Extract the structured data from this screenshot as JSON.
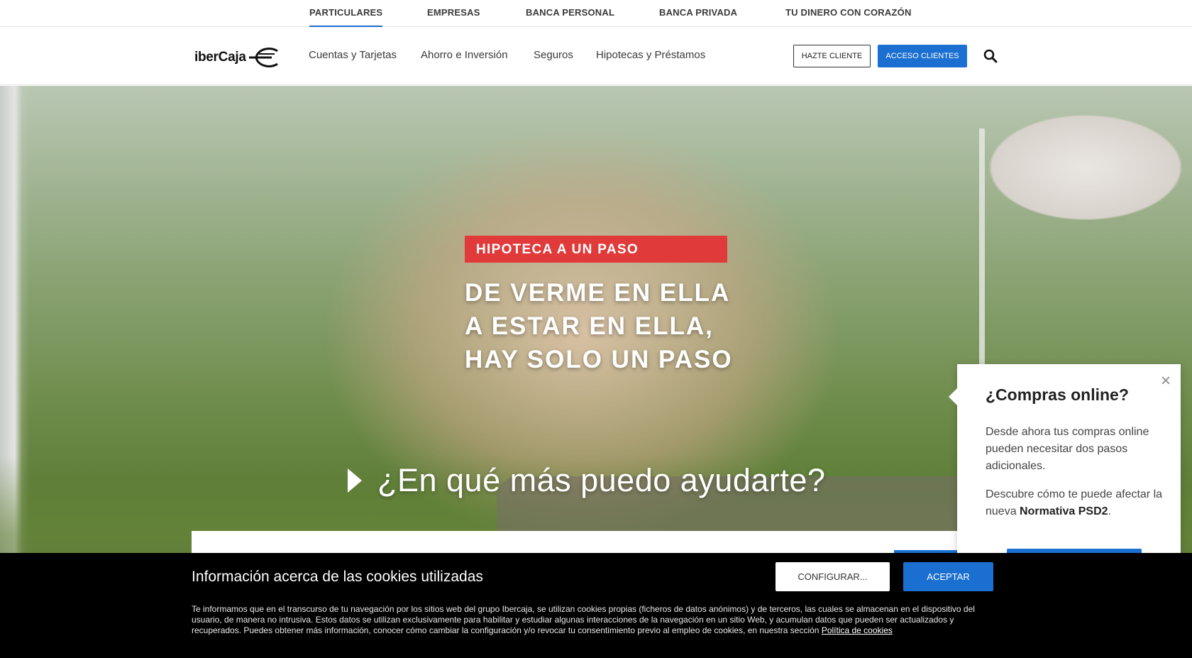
{
  "segments": [
    {
      "label": "PARTICULARES",
      "active": true
    },
    {
      "label": "EMPRESAS",
      "active": false
    },
    {
      "label": "BANCA PERSONAL",
      "active": false
    },
    {
      "label": "BANCA PRIVADA",
      "active": false
    },
    {
      "label": "TU DINERO CON CORAZÓN",
      "active": false
    }
  ],
  "header": {
    "logo_text": "iberCaja",
    "nav": [
      "Cuentas y Tarjetas",
      "Ahorro e Inversión",
      "Seguros",
      "Hipotecas y Préstamos"
    ],
    "hazte_cliente": "HAZTE CLIENTE",
    "acceso_clientes": "ACCESO CLIENTES",
    "search_icon": "search-icon"
  },
  "hero": {
    "tag": "HIPOTECA A UN PASO",
    "headline_lines": [
      "DE VERME EN ELLA",
      "A ESTAR EN ELLA,",
      "HAY SOLO UN PASO"
    ],
    "help_text": "¿En qué más puedo ayudarte?"
  },
  "popup": {
    "title": "¿Compras online?",
    "p1": "Desde ahora tus compras online pueden necesitar dos pasos adicionales.",
    "p2_prefix": "Descubre cómo te puede afectar la nueva ",
    "p2_bold": "Normativa PSD2",
    "p2_suffix": ".",
    "close": "×"
  },
  "cookie": {
    "title": "Información acerca de las cookies utilizadas",
    "configure": "CONFIGURAR...",
    "accept": "ACEPTAR",
    "text": "Te informamos que en el transcurso de tu navegación por los sitios web del grupo Ibercaja, se utilizan cookies propias (ficheros de datos anónimos) y de terceros, las cuales se almacenan en el dispositivo del usuario, de manera no intrusiva. Estos datos se utilizan exclusivamente para habilitar y estudiar algunas interacciones de la navegación en un sitio Web, y acumulan datos que pueden ser actualizados y recuperados. Puedes obtener más información, conocer cómo cambiar la configuración y/o revocar tu consentimiento previo al empleo de cookies, en nuestra sección ",
    "policy_link": "Política de cookies"
  },
  "colors": {
    "accent": "#1a6fd0",
    "tag_red": "#e03a3a"
  }
}
